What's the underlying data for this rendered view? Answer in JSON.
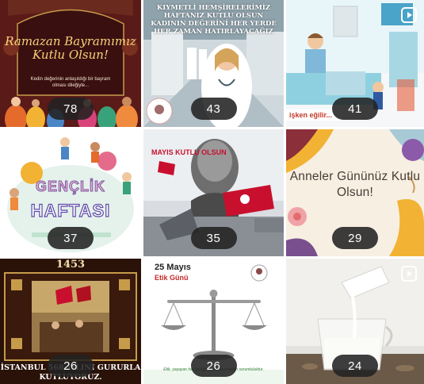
{
  "tiles": [
    {
      "id": "t1",
      "title": "Ramazan Bayramımız Kutlu Olsun!",
      "subtitle": "Kedin değerinin anlaşıldığı bir bayram olması dileğiyle...",
      "count": "78"
    },
    {
      "id": "t2",
      "caption": "KIYMETLİ HEMŞİRELERİMİZ HAFTANIZ KUTLU OLSUN KADININ DEĞERİNİ HER YERDE HER ZAMAN HATIRLAYACAĞIZ",
      "count": "43"
    },
    {
      "id": "t3",
      "caption": "işken eğilir...",
      "count": "41"
    },
    {
      "id": "t4",
      "title_line1": "GENÇLİK",
      "title_line2": "HAFTASI",
      "count": "37"
    },
    {
      "id": "t5",
      "caption": "MAYIS KUTLU OLSUN",
      "count": "35"
    },
    {
      "id": "t6",
      "message": "Anneler Gününüz Kutlu Olsun!",
      "count": "29"
    },
    {
      "id": "t7",
      "year": "1453",
      "bottom_text": "İSTANBUL 568.YILINI GURURLA KUTLUYORUZ.",
      "count": "26"
    },
    {
      "id": "t8",
      "heading": "25 Mayıs",
      "subheading": "Etik Günü",
      "footer": "Etik, yaşayan her varlığa saygı duymaktan sorumluluktur.",
      "count": "26"
    },
    {
      "id": "t9",
      "count": "24"
    }
  ]
}
